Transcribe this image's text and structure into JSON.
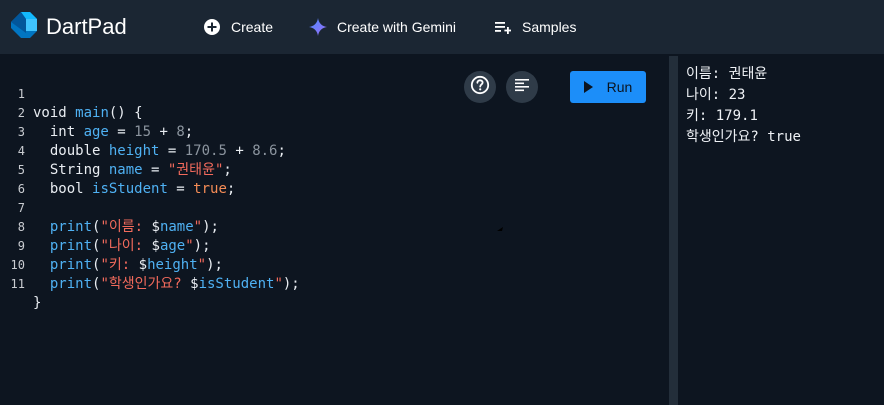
{
  "header": {
    "title": "DartPad",
    "buttons": {
      "create": "Create",
      "gemini": "Create with Gemini",
      "samples": "Samples"
    }
  },
  "editor": {
    "line_numbers": [
      "1",
      "2",
      "3",
      "4",
      "5",
      "6",
      "7",
      "8",
      "9",
      "10",
      "11"
    ],
    "run_label": "Run",
    "code": {
      "l1": {
        "void": "void ",
        "main": "main",
        "rest": "() {"
      },
      "l2": {
        "type": "  int ",
        "name": "age",
        "eq": " = ",
        "a": "15",
        "op": " + ",
        "b": "8",
        "end": ";"
      },
      "l3": {
        "type": "  double ",
        "name": "height",
        "eq": " = ",
        "a": "170.5",
        "op": " + ",
        "b": "8.6",
        "end": ";"
      },
      "l4": {
        "type": "  String ",
        "name": "name",
        "eq": " = ",
        "str": "\"권태윤\"",
        "end": ";"
      },
      "l5": {
        "type": "  bool ",
        "name": "isStudent",
        "eq": " = ",
        "val": "true",
        "end": ";"
      },
      "l7": {
        "fn": "  print",
        "open": "(",
        "str": "\"이름: ",
        "dollar": "$",
        "var": "name",
        "close": "\"",
        "end": ");"
      },
      "l8": {
        "fn": "  print",
        "open": "(",
        "str": "\"나이: ",
        "dollar": "$",
        "var": "age",
        "close": "\"",
        "end": ");"
      },
      "l9": {
        "fn": "  print",
        "open": "(",
        "str": "\"키: ",
        "dollar": "$",
        "var": "height",
        "close": "\"",
        "end": ");"
      },
      "l10": {
        "fn": "  print",
        "open": "(",
        "str": "\"학생인가요? ",
        "dollar": "$",
        "var": "isStudent",
        "close": "\"",
        "end": ");"
      },
      "l11": {
        "text": "}"
      }
    }
  },
  "console": {
    "lines": [
      "이름: 권태윤",
      "나이: 23",
      "키: 179.1",
      "학생인가요? true"
    ]
  },
  "colors": {
    "header_bg": "#1b2633",
    "editor_bg": "#0d1520",
    "run_button": "#1c8ef9",
    "identifier": "#4fb1f3",
    "string": "#f26a5c",
    "number": "#8b949e",
    "boolean": "#f48c56"
  },
  "icons": {
    "logo": "dart-logo-icon",
    "create": "plus-circle-icon",
    "gemini": "gemini-sparkle-icon",
    "samples": "playlist-add-icon",
    "help": "help-icon",
    "format": "format-align-icon",
    "run": "play-icon"
  }
}
